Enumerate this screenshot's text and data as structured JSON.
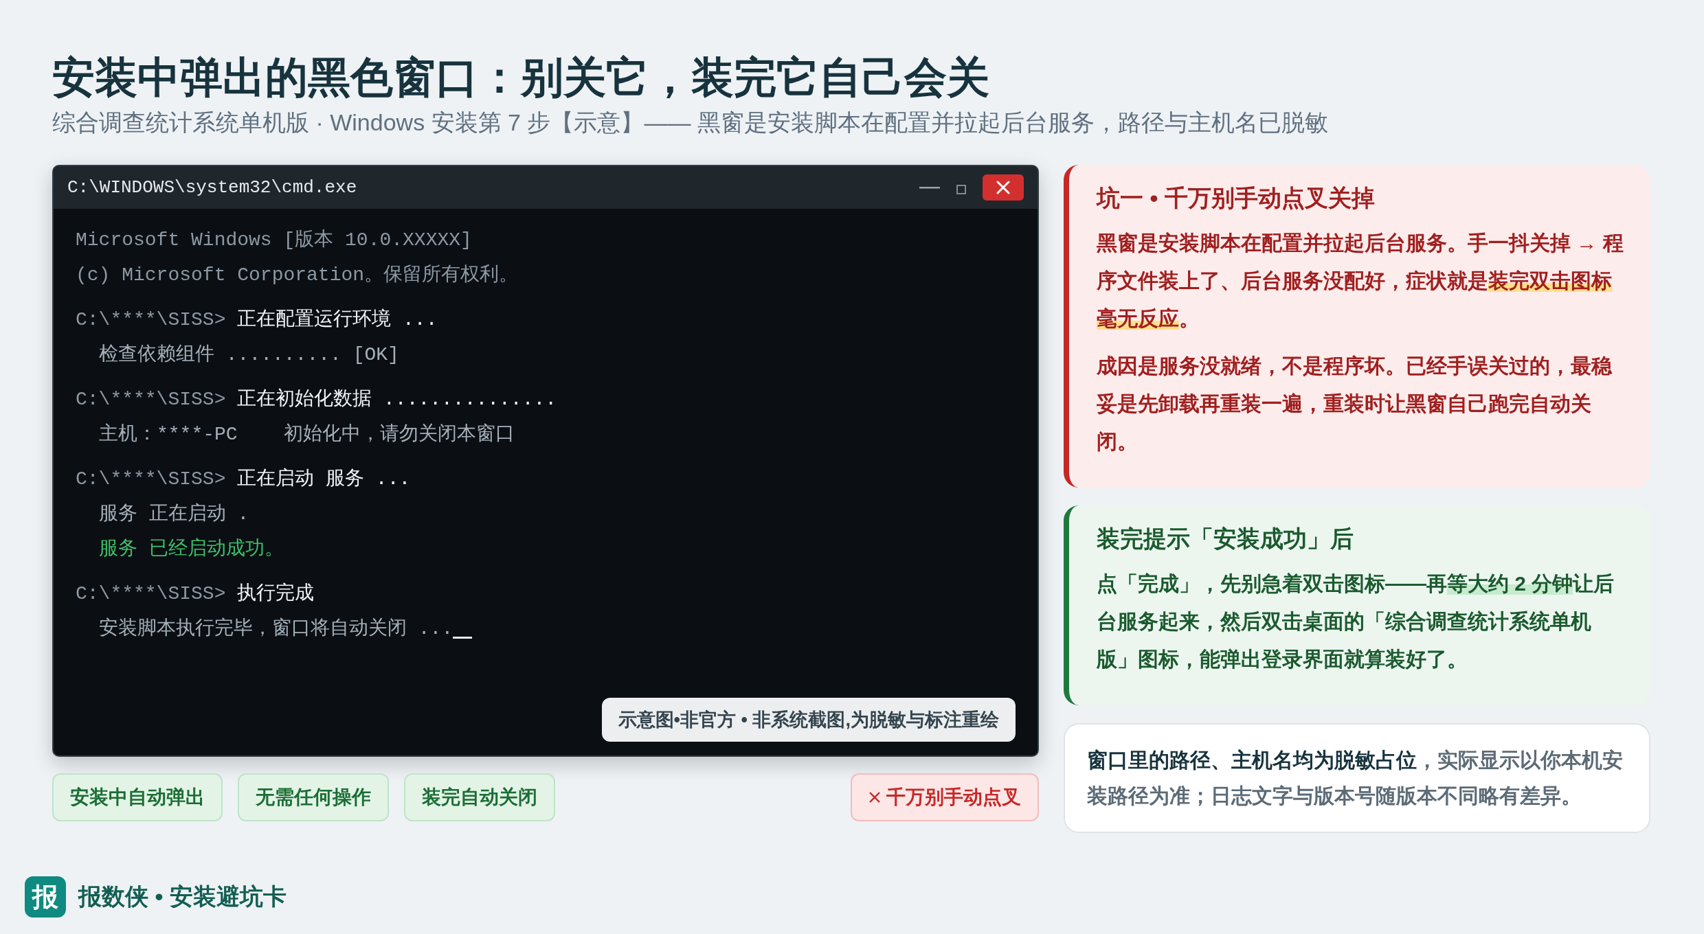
{
  "header": {
    "title": "安装中弹出的黑色窗口：别关它，装完它自己会关",
    "subtitle": "综合调查统计系统单机版 · Windows 安装第 7 步【示意】—— 黑窗是安装脚本在配置并拉起后台服务，路径与主机名已脱敏"
  },
  "terminal": {
    "title": "C:\\WINDOWS\\system32\\cmd.exe",
    "cursor": true,
    "groups": [
      [
        {
          "kind": "info",
          "text": "Microsoft Windows [版本 10.0.XXXXX]"
        },
        {
          "kind": "info",
          "text": "(c) Microsoft Corporation。保留所有权利。"
        }
      ],
      [
        {
          "kind": "prompt",
          "prompt": "C:\\****\\SISS>",
          "text": "正在配置运行环境 ..."
        },
        {
          "kind": "output",
          "text": "检查依赖组件 .......... [OK]"
        }
      ],
      [
        {
          "kind": "prompt",
          "prompt": "C:\\****\\SISS>",
          "text": "正在初始化数据 ..............."
        },
        {
          "kind": "output",
          "text": "主机：****-PC    初始化中，请勿关闭本窗口"
        }
      ],
      [
        {
          "kind": "prompt",
          "prompt": "C:\\****\\SISS>",
          "text": "正在启动 服务 ..."
        },
        {
          "kind": "output",
          "text": "服务 正在启动 ."
        },
        {
          "kind": "success",
          "text": "服务 已经启动成功。"
        }
      ],
      [
        {
          "kind": "prompt",
          "prompt": "C:\\****\\SISS>",
          "text": "执行完成"
        },
        {
          "kind": "output",
          "text": "安装脚本执行完毕，窗口将自动关闭 ..."
        }
      ]
    ],
    "note": "示意图•非官方 • 非系统截图,为脱敏与标注重绘"
  },
  "tags": [
    {
      "kind": "ok",
      "text": "安装中自动弹出"
    },
    {
      "kind": "ok",
      "text": "无需任何操作"
    },
    {
      "kind": "ok",
      "text": "装完自动关闭"
    },
    {
      "kind": "warn",
      "text": "千万别手动点叉"
    }
  ],
  "cards": [
    {
      "kind": "danger",
      "title": "坑一 • 千万别手动点叉关掉",
      "paragraphs": [
        "黑窗是安装脚本在配置并拉起后台服务。手一抖关掉 → 程序文件装上了、后台服务没配好，症状就是**装完双击图标毫无反应**。",
        "成因是服务没就绪，不是程序坏。已经手误关过的，最稳妥是先卸载再重装一遍，重装时让黑窗自己跑完自动关闭。"
      ]
    },
    {
      "kind": "success",
      "title": "装完提示「安装成功」后",
      "paragraphs": [
        "点「完成」，先别急着双击图标——再**等大约 2 分钟**让后台服务起来，然后双击桌面的「综合调查统计系统单机版」图标，能弹出登录界面就算装好了。"
      ]
    },
    {
      "kind": "note",
      "paragraphs": [
        "**窗口里的路径、主机名均为脱敏占位**，实际显示以你本机安装路径为准；日志文字与版本号随版本不同略有差异。"
      ]
    }
  ],
  "footer": {
    "logo": "报",
    "brand": "报数侠 • 安装避坑卡"
  }
}
